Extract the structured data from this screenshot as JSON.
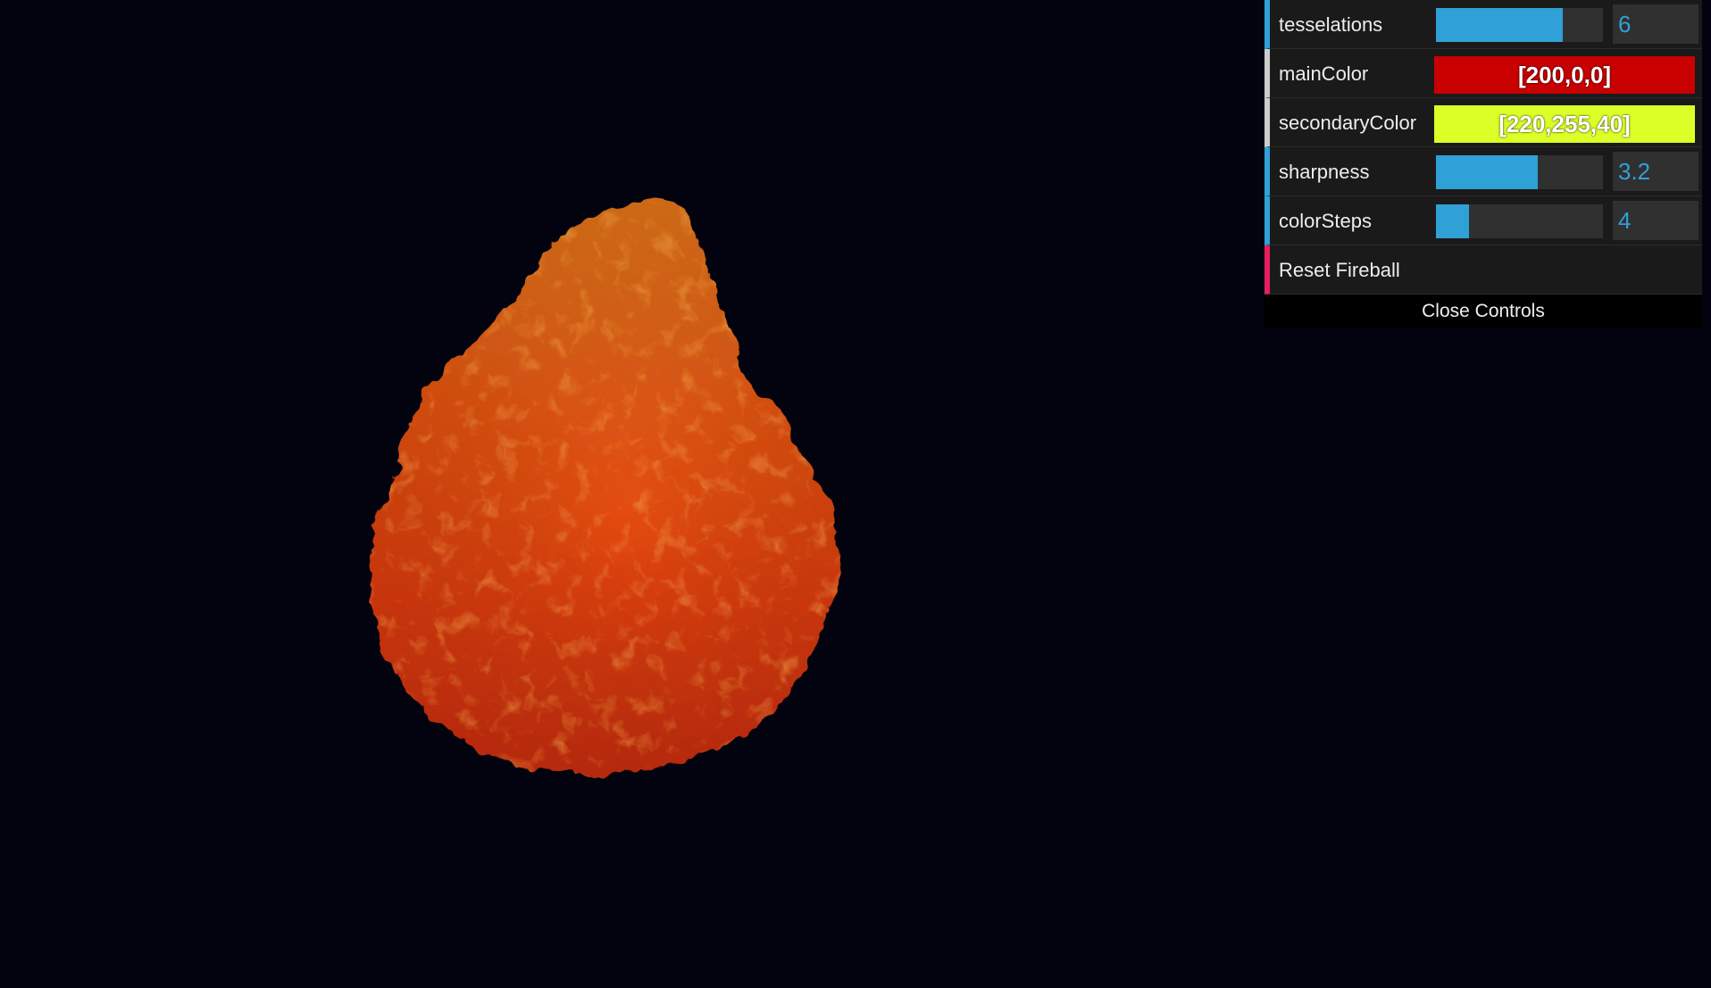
{
  "scene": {
    "background": "#03030f",
    "fireball_colors": {
      "top": "#e8861c",
      "middle": "#e84a12",
      "bottom": "#d63410",
      "speckle": "#f07a20"
    }
  },
  "controls": {
    "tesselations": {
      "label": "tesselations",
      "value": "6",
      "fill": 0.76
    },
    "mainColor": {
      "label": "mainColor",
      "value": "[200,0,0]",
      "hex": "#c80000"
    },
    "secondaryColor": {
      "label": "secondaryColor",
      "value": "[220,255,40]",
      "hex": "#dcff28"
    },
    "sharpness": {
      "label": "sharpness",
      "value": "3.2",
      "fill": 0.61
    },
    "colorSteps": {
      "label": "colorSteps",
      "value": "4",
      "fill": 0.2
    },
    "reset": {
      "label": "Reset Fireball"
    },
    "close": {
      "label": "Close Controls"
    }
  }
}
